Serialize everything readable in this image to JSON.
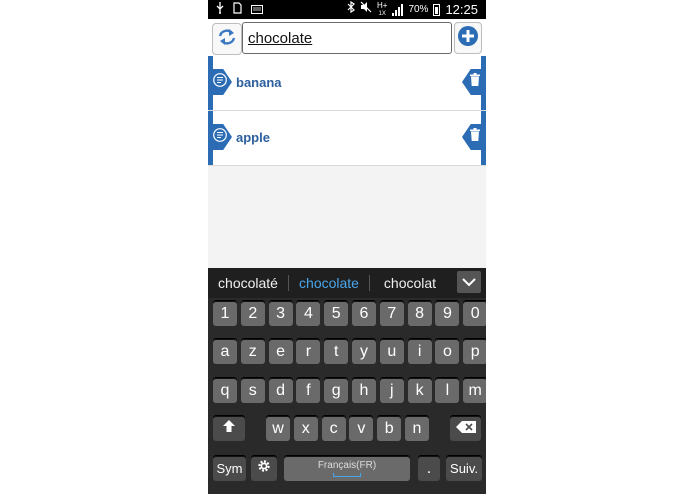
{
  "status_bar": {
    "network": "H+",
    "network_sub": "1X",
    "battery_pct": "70%",
    "time": "12:25",
    "icons": [
      "usb-icon",
      "sd-card-icon",
      "keyboard-icon",
      "bluetooth-icon",
      "mute-icon",
      "signal-icon",
      "battery-icon"
    ]
  },
  "toolbar": {
    "search_value": "chocolate"
  },
  "list": {
    "items": [
      {
        "label": "banana"
      },
      {
        "label": "apple"
      }
    ]
  },
  "suggestions": {
    "items": [
      "chocolaté",
      "chocolate",
      "chocolat"
    ],
    "highlight_color": "#4aa6ec"
  },
  "keyboard": {
    "row1": [
      "1",
      "2",
      "3",
      "4",
      "5",
      "6",
      "7",
      "8",
      "9",
      "0"
    ],
    "row2": [
      "a",
      "z",
      "e",
      "r",
      "t",
      "y",
      "u",
      "i",
      "o",
      "p"
    ],
    "row3": [
      "q",
      "s",
      "d",
      "f",
      "g",
      "h",
      "j",
      "k",
      "l",
      "m"
    ],
    "row4": [
      "w",
      "x",
      "c",
      "v",
      "b",
      "n"
    ],
    "sym_label": "Sym",
    "space_label": "Français(FR)",
    "period_label": ".",
    "next_label": "Suiv."
  },
  "colors": {
    "accent": "#2b6cb5",
    "item_text": "#2b5f9e"
  }
}
